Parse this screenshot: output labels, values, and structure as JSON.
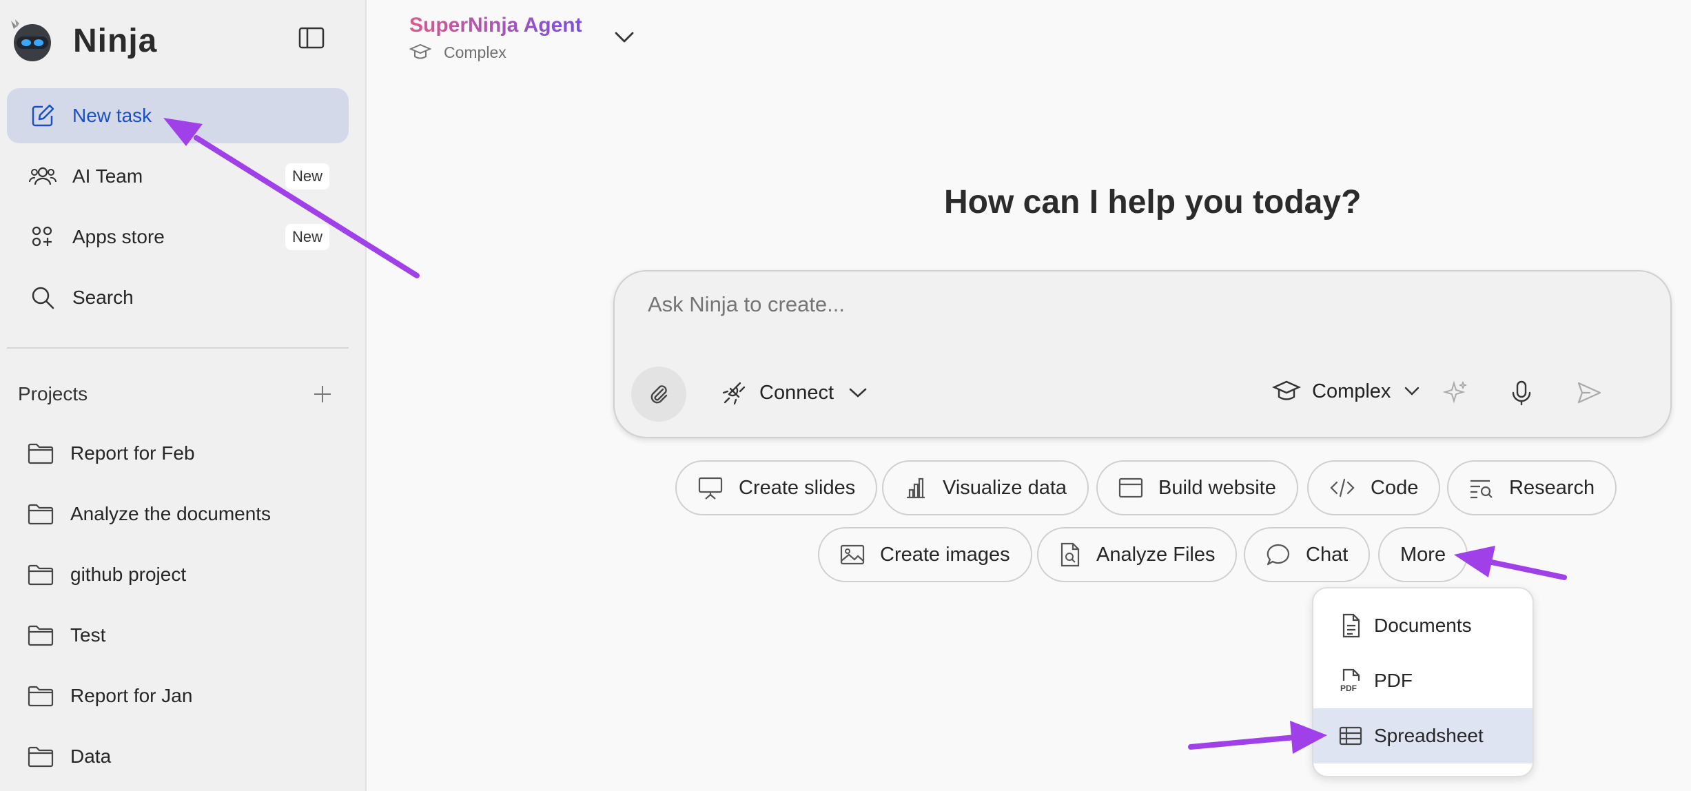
{
  "sidebar": {
    "brand": "Ninja",
    "nav": [
      {
        "label": "New task",
        "badge": ""
      },
      {
        "label": "AI Team",
        "badge": "New"
      },
      {
        "label": "Apps store",
        "badge": "New"
      },
      {
        "label": "Search",
        "badge": ""
      }
    ],
    "projects_title": "Projects",
    "projects": [
      "Report for Feb",
      "Analyze the documents",
      "github project",
      "Test",
      "Report for Jan",
      "Data"
    ]
  },
  "header": {
    "agent_title": "SuperNinja Agent",
    "agent_mode": "Complex"
  },
  "main": {
    "heading": "How can I help you today?",
    "composer": {
      "placeholder": "Ask Ninja to create...",
      "connect_label": "Connect",
      "mode_label": "Complex"
    },
    "chips": [
      "Create slides",
      "Visualize data",
      "Build website",
      "Code",
      "Research",
      "Create images",
      "Analyze Files",
      "Chat",
      "More"
    ],
    "more_menu": [
      "Documents",
      "PDF",
      "Spreadsheet"
    ]
  },
  "colors": {
    "accent": "#1a4fc7",
    "active_bg": "#d4d9e9",
    "annotation_arrow": "#a040e8",
    "menu_highlight": "#dfe4f3"
  }
}
